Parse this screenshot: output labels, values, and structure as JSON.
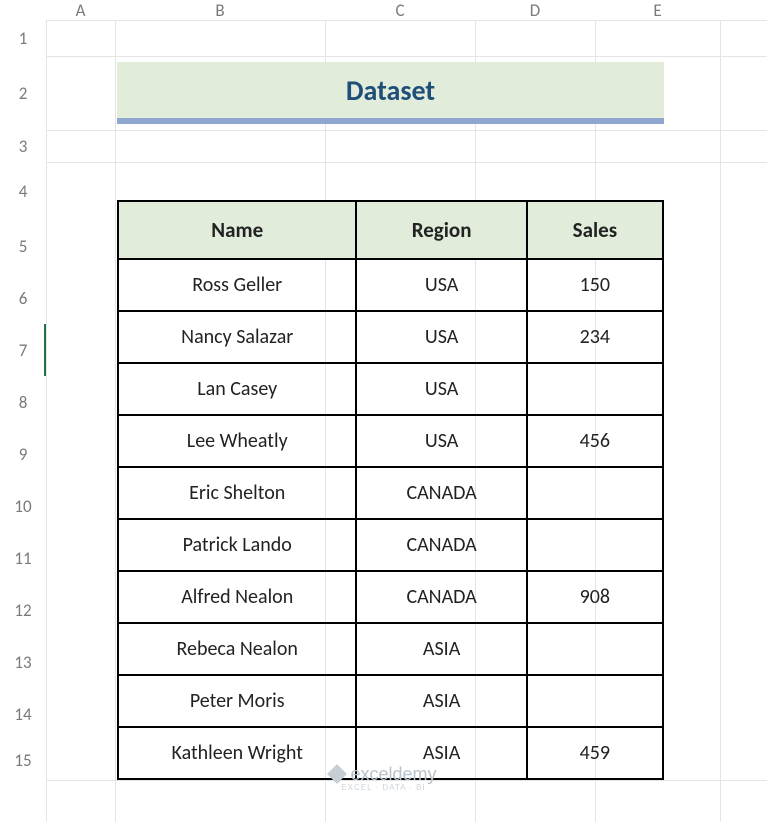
{
  "columns": [
    "A",
    "B",
    "C",
    "D",
    "E"
  ],
  "rows": [
    "1",
    "2",
    "3",
    "4",
    "5",
    "6",
    "7",
    "8",
    "9",
    "10",
    "11",
    "12",
    "13",
    "14",
    "15"
  ],
  "selected_row": "7",
  "title": "Dataset",
  "headers": {
    "name": "Name",
    "region": "Region",
    "sales": "Sales"
  },
  "data": [
    {
      "name": "Ross Geller",
      "region": "USA",
      "sales": "150"
    },
    {
      "name": "Nancy Salazar",
      "region": "USA",
      "sales": "234"
    },
    {
      "name": "Lan Casey",
      "region": "USA",
      "sales": ""
    },
    {
      "name": "Lee Wheatly",
      "region": "USA",
      "sales": "456"
    },
    {
      "name": "Eric Shelton",
      "region": "CANADA",
      "sales": ""
    },
    {
      "name": "Patrick Lando",
      "region": "CANADA",
      "sales": ""
    },
    {
      "name": "Alfred Nealon",
      "region": "CANADA",
      "sales": "908"
    },
    {
      "name": "Rebeca Nealon",
      "region": "ASIA",
      "sales": ""
    },
    {
      "name": "Peter Moris",
      "region": "ASIA",
      "sales": ""
    },
    {
      "name": "Kathleen Wright",
      "region": "ASIA",
      "sales": "459"
    }
  ],
  "watermark": {
    "brand": "exceldemy",
    "sub": "EXCEL · DATA · BI"
  },
  "colors": {
    "header_fill": "#e1ecdb",
    "title_accent": "#8fa7cf",
    "title_text": "#1f4e79"
  }
}
